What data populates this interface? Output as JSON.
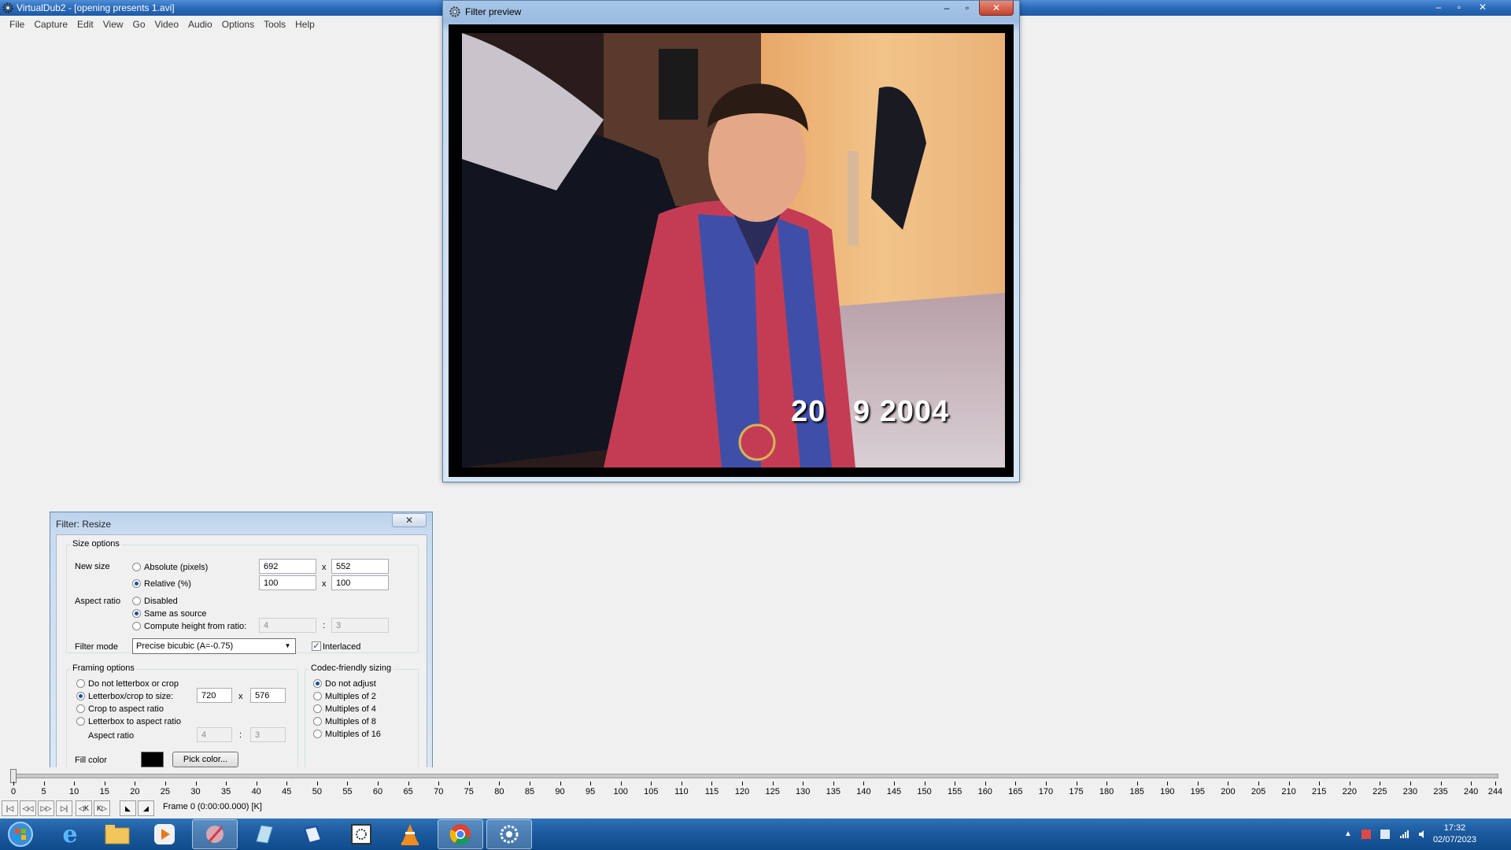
{
  "main_window": {
    "title": "VirtualDub2 - [opening presents 1.avi]",
    "minimize": "–",
    "maximize": "▫",
    "close": "✕"
  },
  "menu": [
    "File",
    "Capture",
    "Edit",
    "View",
    "Go",
    "Video",
    "Audio",
    "Options",
    "Tools",
    "Help"
  ],
  "preview": {
    "title": "Filter preview",
    "minimize": "–",
    "maximize": "▫",
    "close": "✕",
    "video_timestamp": "20   9 2004"
  },
  "resize_dialog": {
    "title": "Filter: Resize",
    "close": "✕",
    "size_options": {
      "group_label": "Size options",
      "new_size_label": "New size",
      "absolute_label": "Absolute (pixels)",
      "absolute_w": "692",
      "absolute_h": "552",
      "relative_label": "Relative (%)",
      "relative_w": "100",
      "relative_h": "100",
      "x_sep": "x",
      "aspect_ratio_label": "Aspect ratio",
      "disabled_label": "Disabled",
      "same_as_source_label": "Same as source",
      "compute_height_label": "Compute height from ratio:",
      "ratio_a": "4",
      "ratio_b": "3",
      "colon": ":",
      "filter_mode_label": "Filter mode",
      "filter_mode_value": "Precise bicubic (A=-0.75)",
      "interlaced_label": "Interlaced",
      "interlaced_checked": true
    },
    "framing": {
      "group_label": "Framing options",
      "no_letterbox_label": "Do not letterbox or crop",
      "letterbox_crop_label": "Letterbox/crop to size:",
      "letterbox_w": "720",
      "letterbox_h": "576",
      "crop_aspect_label": "Crop to aspect ratio",
      "letterbox_aspect_label": "Letterbox to aspect ratio",
      "aspect_ratio_label": "Aspect ratio",
      "aspect_a": "4",
      "aspect_b": "3",
      "fill_color_label": "Fill color",
      "fill_color": "#000000",
      "pick_color_label": "Pick color..."
    },
    "codec": {
      "group_label": "Codec-friendly sizing",
      "options": [
        "Do not adjust",
        "Multiples of 2",
        "Multiples of 4",
        "Multiples of 8",
        "Multiples of 16"
      ],
      "selected": 0
    }
  },
  "timeline": {
    "ticks": [
      "0",
      "5",
      "10",
      "15",
      "20",
      "25",
      "30",
      "35",
      "40",
      "45",
      "50",
      "55",
      "60",
      "65",
      "70",
      "75",
      "80",
      "85",
      "90",
      "95",
      "100",
      "105",
      "110",
      "115",
      "120",
      "125",
      "130",
      "135",
      "140",
      "145",
      "150",
      "155",
      "160",
      "165",
      "170",
      "175",
      "180",
      "185",
      "190",
      "195",
      "200",
      "205",
      "210",
      "215",
      "220",
      "225",
      "230",
      "235",
      "240",
      "244"
    ],
    "current_frame": 0,
    "total_frames": 244
  },
  "status": {
    "frame_text": "Frame 0 (0:00:00.000) [K]"
  },
  "taskbar": {
    "apps": [
      "start-orb",
      "internet-explorer",
      "file-explorer",
      "media-player",
      "paint",
      "notes-app",
      "pen-app",
      "virtualdub-film",
      "vlc",
      "chrome",
      "virtualdub2"
    ],
    "active_app": "virtualdub2",
    "time": "17:32",
    "date": "02/07/2023"
  },
  "colors": {
    "taskbar": "#1c5a9e",
    "titlebar": "#2b6ab8",
    "accent": "#1c4f9c"
  }
}
